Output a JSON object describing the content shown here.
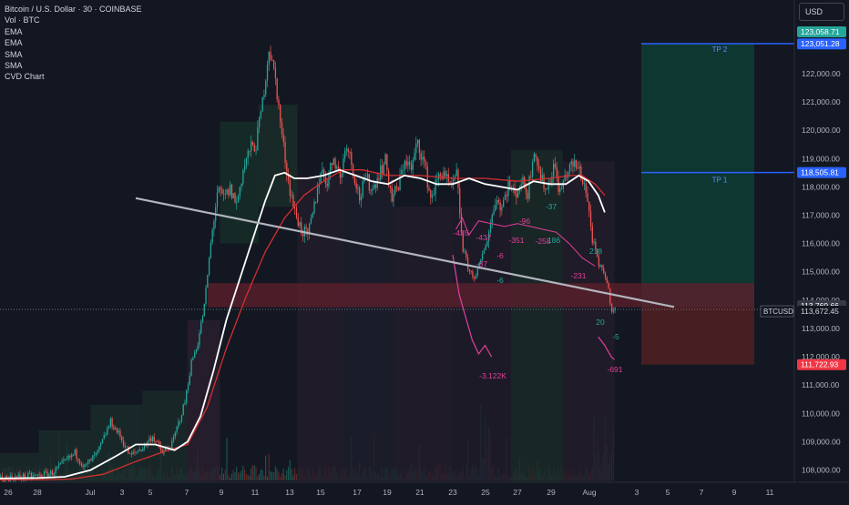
{
  "header": {
    "title": "Bitcoin / U.S. Dollar · 30 · COINBASE",
    "indicators": [
      "Vol · BTC",
      "EMA",
      "EMA",
      "SMA",
      "SMA",
      "CVD Chart"
    ],
    "currency_button": "USD"
  },
  "colors": {
    "background": "#131722",
    "up_candle": "#26a69a",
    "down_candle": "#ef5350",
    "profit_zone": "#0f3b34",
    "loss_zone": "#4a1f22",
    "tp_line": "#2962ff",
    "trendline": "#b2b5be",
    "ema_fast": "#ffffff",
    "ema_slow": "#d32f2f",
    "cvd": "#e0409a"
  },
  "chart_data": {
    "type": "candlestick",
    "symbol": "BTCUSD",
    "exchange": "COINBASE",
    "interval": "30",
    "ylim": [
      107600,
      124600
    ],
    "yticks": [
      108000,
      109000,
      110000,
      111000,
      112000,
      113000,
      114000,
      115000,
      116000,
      117000,
      118000,
      119000,
      120000,
      121000,
      122000
    ],
    "ytick_labels": [
      "108,000.00",
      "109,000.00",
      "110,000.00",
      "111,000.00",
      "112,000.00",
      "113,000.00",
      "114,000.00",
      "115,000.00",
      "116,000.00",
      "117,000.00",
      "118,000.00",
      "119,000.00",
      "120,000.00",
      "121,000.00",
      "122,000.00"
    ],
    "xtick_labels": [
      "26",
      "28",
      "Jul",
      "3",
      "5",
      "7",
      "9",
      "11",
      "13",
      "15",
      "17",
      "19",
      "21",
      "23",
      "25",
      "27",
      "29",
      "Aug",
      "3",
      "5",
      "7",
      "9",
      "11"
    ],
    "price_path": [
      [
        0,
        107700
      ],
      [
        6,
        107750
      ],
      [
        12,
        107800
      ],
      [
        16,
        107900
      ],
      [
        20,
        108300
      ],
      [
        23,
        108600
      ],
      [
        26,
        108100
      ],
      [
        30,
        108600
      ],
      [
        34,
        109700
      ],
      [
        37,
        109200
      ],
      [
        40,
        108500
      ],
      [
        44,
        108800
      ],
      [
        47,
        109200
      ],
      [
        50,
        108600
      ],
      [
        53,
        108900
      ],
      [
        57,
        110400
      ],
      [
        59,
        111800
      ],
      [
        61,
        112500
      ],
      [
        63,
        113800
      ],
      [
        65,
        116000
      ],
      [
        67,
        117800
      ],
      [
        69,
        117600
      ],
      [
        71,
        117900
      ],
      [
        73,
        117400
      ],
      [
        75,
        118600
      ],
      [
        77,
        119300
      ],
      [
        79,
        119500
      ],
      [
        81,
        121000
      ],
      [
        83,
        122900
      ],
      [
        85,
        121800
      ],
      [
        87,
        119800
      ],
      [
        89,
        118200
      ],
      [
        91,
        117100
      ],
      [
        93,
        116500
      ],
      [
        95,
        116200
      ],
      [
        97,
        117300
      ],
      [
        99,
        118600
      ],
      [
        101,
        118200
      ],
      [
        103,
        119100
      ],
      [
        105,
        118300
      ],
      [
        107,
        119600
      ],
      [
        109,
        118600
      ],
      [
        111,
        117600
      ],
      [
        113,
        118300
      ],
      [
        115,
        117900
      ],
      [
        117,
        118500
      ],
      [
        119,
        118900
      ],
      [
        121,
        117600
      ],
      [
        123,
        118000
      ],
      [
        125,
        119000
      ],
      [
        127,
        118600
      ],
      [
        129,
        119600
      ],
      [
        131,
        118800
      ],
      [
        133,
        117600
      ],
      [
        135,
        118200
      ],
      [
        137,
        118600
      ],
      [
        139,
        117900
      ],
      [
        141,
        118400
      ],
      [
        143,
        115800
      ],
      [
        145,
        115000
      ],
      [
        147,
        114800
      ],
      [
        149,
        115600
      ],
      [
        151,
        116400
      ],
      [
        153,
        117600
      ],
      [
        155,
        117300
      ],
      [
        157,
        118100
      ],
      [
        159,
        117700
      ],
      [
        161,
        118200
      ],
      [
        163,
        117800
      ],
      [
        165,
        119400
      ],
      [
        167,
        118300
      ],
      [
        169,
        117900
      ],
      [
        171,
        118800
      ],
      [
        173,
        117800
      ],
      [
        175,
        118500
      ],
      [
        177,
        118800
      ],
      [
        179,
        118600
      ],
      [
        181,
        117900
      ],
      [
        183,
        116200
      ],
      [
        185,
        115200
      ],
      [
        187,
        114900
      ],
      [
        189,
        113700
      ],
      [
        190,
        113672
      ]
    ],
    "ema_fast": [
      [
        0,
        107700
      ],
      [
        12,
        107720
      ],
      [
        20,
        107760
      ],
      [
        28,
        108000
      ],
      [
        36,
        108500
      ],
      [
        42,
        108900
      ],
      [
        48,
        108900
      ],
      [
        54,
        108700
      ],
      [
        58,
        109000
      ],
      [
        62,
        109900
      ],
      [
        66,
        111500
      ],
      [
        70,
        113300
      ],
      [
        74,
        114700
      ],
      [
        78,
        116100
      ],
      [
        82,
        117500
      ],
      [
        85,
        118400
      ],
      [
        88,
        118500
      ],
      [
        91,
        118300
      ],
      [
        95,
        118300
      ],
      [
        100,
        118400
      ],
      [
        105,
        118600
      ],
      [
        110,
        118400
      ],
      [
        115,
        118200
      ],
      [
        120,
        118100
      ],
      [
        125,
        118400
      ],
      [
        130,
        118300
      ],
      [
        135,
        118100
      ],
      [
        140,
        118100
      ],
      [
        145,
        118300
      ],
      [
        150,
        118100
      ],
      [
        155,
        118000
      ],
      [
        160,
        117900
      ],
      [
        165,
        118200
      ],
      [
        170,
        118100
      ],
      [
        175,
        118100
      ],
      [
        179,
        118400
      ],
      [
        182,
        118200
      ],
      [
        185,
        117700
      ],
      [
        187,
        117100
      ]
    ],
    "ema_slow": [
      [
        0,
        107650
      ],
      [
        12,
        107650
      ],
      [
        22,
        107680
      ],
      [
        32,
        107850
      ],
      [
        42,
        108300
      ],
      [
        52,
        108700
      ],
      [
        58,
        108900
      ],
      [
        64,
        110200
      ],
      [
        70,
        112300
      ],
      [
        76,
        114100
      ],
      [
        82,
        115700
      ],
      [
        88,
        116900
      ],
      [
        94,
        117700
      ],
      [
        100,
        118200
      ],
      [
        106,
        118600
      ],
      [
        112,
        118600
      ],
      [
        120,
        118400
      ],
      [
        130,
        118400
      ],
      [
        140,
        118300
      ],
      [
        150,
        118300
      ],
      [
        160,
        118200
      ],
      [
        170,
        118300
      ],
      [
        176,
        118400
      ],
      [
        180,
        118400
      ],
      [
        184,
        118100
      ],
      [
        187,
        117700
      ]
    ],
    "cvd_labels": [
      "-435",
      "-437",
      "-87",
      "-6",
      "-96",
      "-351",
      "-258",
      "-231",
      "-3.122K",
      "-691",
      "20",
      "-5",
      "218",
      "186",
      "-37",
      "-6"
    ],
    "positions": {
      "tp2_price": 123058.71,
      "tp2_label_price": 123051.28,
      "tp1_price": 118505.81,
      "entry_price": 113769.66,
      "stop_price": 111722.93,
      "current_price": 113672.45
    },
    "labels": {
      "tp2": "TP 2",
      "tp1": "TP 1",
      "tp2_top": "123,058.71",
      "tp2_price": "123,051.28",
      "tp1_price": "118,505.81",
      "entry_price": "113,769.66",
      "current_price": "113,672.45",
      "stop_price": "111,722.93",
      "ticker_tag": "BTCUSD"
    },
    "trendline": {
      "start": [
        55,
        117600
      ],
      "end": [
        230,
        113760
      ]
    },
    "grid": false
  }
}
